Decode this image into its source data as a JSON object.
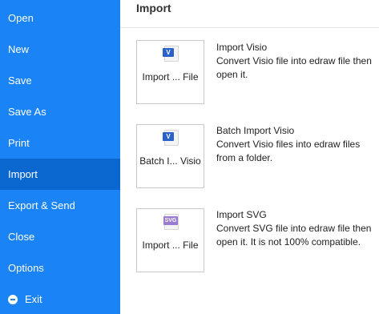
{
  "sidebar": {
    "items": [
      {
        "label": "Open"
      },
      {
        "label": "New"
      },
      {
        "label": "Save"
      },
      {
        "label": "Save As"
      },
      {
        "label": "Print"
      },
      {
        "label": "Import",
        "active": true
      },
      {
        "label": "Export & Send"
      },
      {
        "label": "Close"
      },
      {
        "label": "Options"
      },
      {
        "label": "Exit",
        "icon": "exit-icon"
      }
    ],
    "background_color": "#1a83f6",
    "active_color": "#0b67d0"
  },
  "main": {
    "title": "Import",
    "options": [
      {
        "button_label": "Import ... File",
        "icon": "visio-file-icon",
        "icon_badge": "V",
        "title": "Import Visio",
        "description": "Convert Visio file into edraw file then open it."
      },
      {
        "button_label": "Batch I... Visio",
        "icon": "visio-file-icon",
        "icon_badge": "V",
        "title": "Batch Import Visio",
        "description": "Convert Visio files into edraw files from a folder."
      },
      {
        "button_label": "Import ... File",
        "icon": "svg-file-icon",
        "icon_badge": "SVG",
        "title": "Import SVG",
        "description": "Convert SVG file into edraw file then open it. It is not 100% compatible."
      }
    ]
  }
}
